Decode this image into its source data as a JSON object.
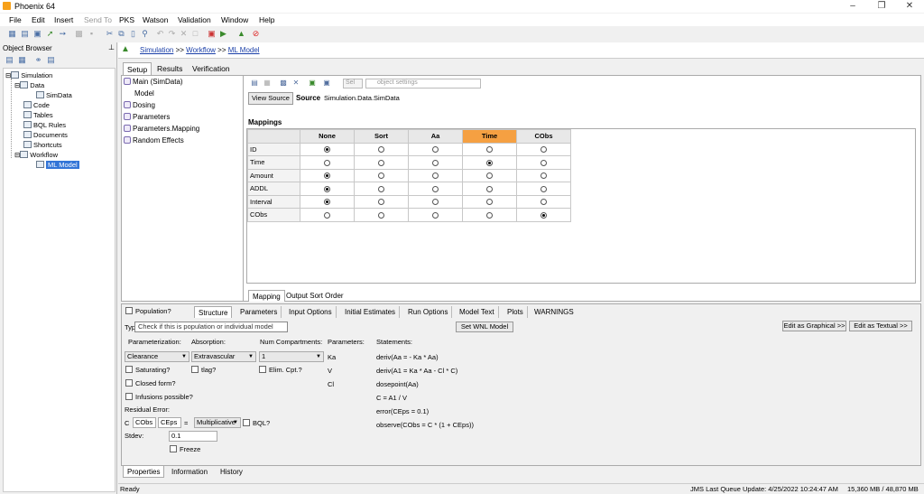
{
  "window": {
    "title": "Phoenix 64"
  },
  "menu": [
    "File",
    "Edit",
    "Insert",
    "Send To",
    "PKS",
    "Watson",
    "Validation",
    "Window",
    "Help"
  ],
  "object_browser": {
    "header": "Object Browser",
    "tree": {
      "simulation": "Simulation",
      "data": "Data",
      "simdata": "SimData",
      "code": "Code",
      "tables": "Tables",
      "bql": "BQL Rules",
      "documents": "Documents",
      "shortcuts": "Shortcuts",
      "workflow": "Workflow",
      "ml_model": "ML Model"
    }
  },
  "breadcrumb": {
    "c1": "Simulation",
    "sep1": ">>",
    "c2": "Workflow",
    "sep2": ">>",
    "c3": "ML Model"
  },
  "top_tabs": [
    "Setup",
    "Results",
    "Verification"
  ],
  "model_tree": [
    "Main (SimData)",
    "Model",
    "Dosing",
    "Parameters",
    "Parameters.Mapping",
    "Random Effects"
  ],
  "toolbar2": {
    "sel": "Sel",
    "obj_settings": "object settings"
  },
  "source": {
    "button": "View Source",
    "label": "Source",
    "value": "Simulation.Data.SimData"
  },
  "mappings": {
    "title": "Mappings",
    "columns": [
      "None",
      "Sort",
      "Aa",
      "Time",
      "CObs"
    ],
    "highlight_col": 3,
    "rows": [
      {
        "name": "ID",
        "sel": 0
      },
      {
        "name": "Time",
        "sel": 3
      },
      {
        "name": "Amount",
        "sel": 0
      },
      {
        "name": "ADDL",
        "sel": 0
      },
      {
        "name": "Interval",
        "sel": 0
      },
      {
        "name": "CObs",
        "sel": 4
      }
    ]
  },
  "mapping_tabs": [
    "Mapping",
    "Output Sort Order"
  ],
  "lower": {
    "population": "Population?",
    "tabs": [
      "Structure",
      "Parameters",
      "Input Options",
      "Initial Estimates",
      "Run Options",
      "Model Text",
      "Plots",
      "WARNINGS"
    ],
    "tooltip": "Check if this is population or individual model",
    "type_label": "Type",
    "set_wnl": "Set WNL Model",
    "edit_graphical": "Edit as Graphical >>",
    "edit_textual": "Edit as Textual >>",
    "parameterization_lbl": "Parameterization:",
    "parameterization_val": "Clearance",
    "absorption_lbl": "Absorption:",
    "absorption_val": "Extravascular",
    "num_comp_lbl": "Num Compartments:",
    "num_comp_val": "1",
    "saturating": "Saturating?",
    "tlag": "tlag?",
    "elim_cpt": "Elim. Cpt.?",
    "closed_form": "Closed form?",
    "infusions": "Infusions possible?",
    "residual_error": "Residual Error:",
    "c_lbl": "C",
    "cobs": "CObs",
    "ceps": "CEps",
    "eq": "=",
    "multiplicative": "Multiplicative",
    "bql": "BQL?",
    "stdev_lbl": "Stdev:",
    "stdev_val": "0.1",
    "freeze": "Freeze",
    "parameters_lbl": "Parameters:",
    "params": [
      "Ka",
      "V",
      "Cl"
    ],
    "statements_lbl": "Statements:",
    "statements": [
      "deriv(Aa = - Ka * Aa)",
      "deriv(A1 = Ka * Aa - Cl * C)",
      "dosepoint(Aa)",
      "C = A1 / V",
      "error(CEps = 0.1)",
      "observe(CObs = C * (1 + CEps))"
    ]
  },
  "bottom_tabs": [
    "Properties",
    "Information",
    "History"
  ],
  "status": {
    "ready": "Ready",
    "queue": "JMS Last Queue Update: 4/25/2022 10:24:47 AM",
    "memory": "15,360 MB / 48,870 MB"
  }
}
